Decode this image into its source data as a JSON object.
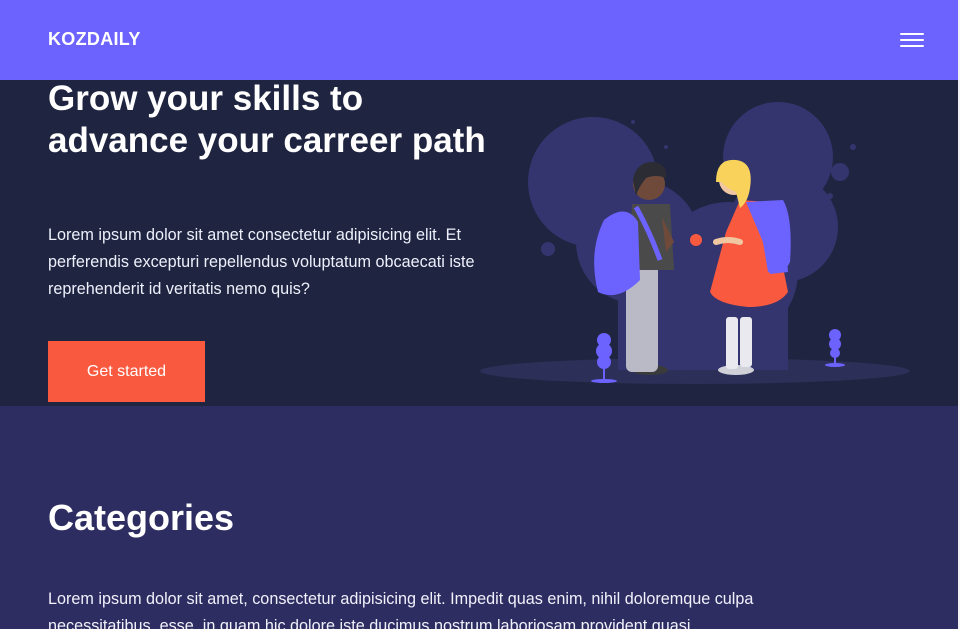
{
  "header": {
    "logo": "KOZDAILY",
    "menu_icon": "hamburger-menu-icon"
  },
  "hero": {
    "title": "Grow your skills to advance your carreer path",
    "description": "Lorem ipsum dolor sit amet consectetur adipisicing elit. Et perferendis excepturi repellendus voluptatum obcaecati iste reprehenderit id veritatis nemo quis?",
    "cta_label": "Get started",
    "illustration": "students-with-backpacks-illustration"
  },
  "categories": {
    "title": "Categories",
    "description": "Lorem ipsum dolor sit amet, consectetur adipisicing elit. Impedit quas enim, nihil doloremque culpa necessitatibus, esse, in quam hic dolore iste ducimus nostrum laboriosam provident quasi"
  },
  "colors": {
    "header_bg": "#6c63ff",
    "hero_bg": "#1f2440",
    "section_bg": "#2e2d62",
    "accent": "#f9593f"
  }
}
